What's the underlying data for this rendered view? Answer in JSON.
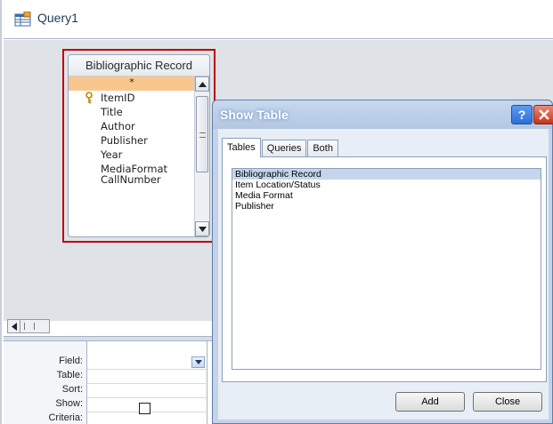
{
  "query_tab": {
    "title": "Query1",
    "icon": "query-icon"
  },
  "table_box": {
    "title": "Bibliographic Record",
    "fields": [
      "*",
      "ItemID",
      "Title",
      "Author",
      "Publisher",
      "Year",
      "MediaFormat",
      "CallNumber"
    ],
    "selected_index": 0,
    "key_field_index": 1,
    "highlight_color": "#c00000"
  },
  "grid": {
    "labels": [
      "Field:",
      "Table:",
      "Sort:",
      "Show:",
      "Criteria:"
    ],
    "field_value": "",
    "show_checked": false
  },
  "dialog": {
    "title": "Show Table",
    "help_label": "?",
    "tabs": [
      "Tables",
      "Queries",
      "Both"
    ],
    "active_tab": "Tables",
    "items": [
      "Bibliographic Record",
      "Item Location/Status",
      "Media Format",
      "Publisher"
    ],
    "selected_item": "Bibliographic Record",
    "add_label": "Add",
    "close_label": "Close"
  }
}
